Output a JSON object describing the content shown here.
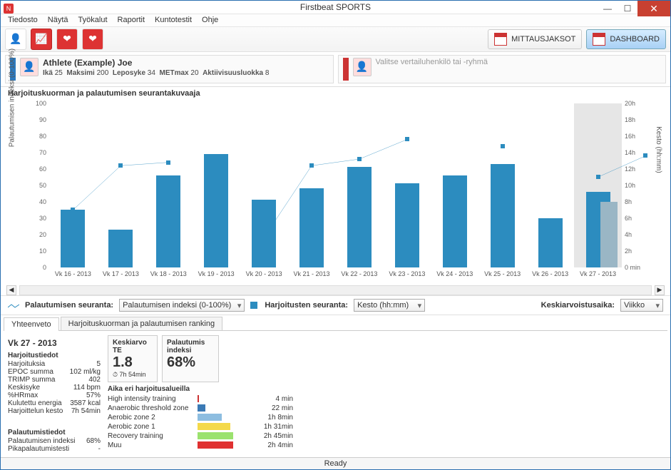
{
  "app": {
    "title": "Firstbeat SPORTS"
  },
  "menu": [
    "Tiedosto",
    "Näytä",
    "Työkalut",
    "Raportit",
    "Kuntotestit",
    "Ohje"
  ],
  "toolbar_right": {
    "mittaus": "MITTAUSJAKSOT",
    "dashboard": "DASHBOARD"
  },
  "athlete": {
    "name": "Athlete (Example) Joe",
    "ika_lbl": "Ikä",
    "ika": "25",
    "maksimi_lbl": "Maksimi",
    "maksimi": "200",
    "lepo_lbl": "Leposyke",
    "lepo": "34",
    "met_lbl": "METmax",
    "met": "20",
    "akt_lbl": "Aktiivisuusluokka",
    "akt": "8",
    "compare_placeholder": "Valitse vertailuhenkilö tai -ryhmä"
  },
  "chart_title": "Harjoituskuorman ja palautumisen seurantakuvaaja",
  "chart_data": {
    "type": "bar+line",
    "categories": [
      "Vk 16 - 2013",
      "Vk 17 - 2013",
      "Vk 18 - 2013",
      "Vk 19 - 2013",
      "Vk 20 - 2013",
      "Vk 21 - 2013",
      "Vk 22 - 2013",
      "Vk 23 - 2013",
      "Vk 24 - 2013",
      "Vk 25 - 2013",
      "Vk 26 - 2013",
      "Vk 27 - 2013"
    ],
    "series": [
      {
        "name": "Palautumisen indeksi (0-100%)",
        "axis": "left",
        "type": "bar",
        "values": [
          35,
          23,
          56,
          69,
          41,
          48,
          61,
          51,
          56,
          63,
          30,
          46,
          40
        ]
      },
      {
        "name": "Kesto (hh:mm)",
        "axis": "right",
        "type": "line",
        "values": [
          7,
          12.4,
          12.8,
          null,
          3.6,
          12.4,
          13.2,
          15.6,
          null,
          14.8,
          null,
          11,
          13.6
        ]
      }
    ],
    "ylabel_left": "Palautumisen indeksi (0-100%)",
    "ylabel_right": "Kesto (hh:mm)",
    "ylim_left": [
      0,
      100
    ],
    "ylim_right": [
      0,
      20
    ],
    "highlight_index": 11,
    "yticks_left": [
      "0",
      "10",
      "20",
      "30",
      "40",
      "50",
      "60",
      "70",
      "80",
      "90",
      "100"
    ],
    "yticks_right": [
      "0 min",
      "2h",
      "4h",
      "6h",
      "8h",
      "10h",
      "12h",
      "14h",
      "16h",
      "18h",
      "20h"
    ]
  },
  "filters": {
    "pal_lbl": "Palautumisen seuranta:",
    "pal_sel": "Palautumisen indeksi (0-100%)",
    "har_lbl": "Harjoitusten seuranta:",
    "har_sel": "Kesto (hh:mm)",
    "avg_lbl": "Keskiarvoistusaika:",
    "avg_sel": "Viikko"
  },
  "tabs": {
    "t1": "Yhteenveto",
    "t2": "Harjoituskuorman ja palautumisen ranking"
  },
  "summary": {
    "header": "Vk 27 - 2013",
    "harj_hd": "Harjoitustiedot",
    "rows": [
      [
        "Harjoituksia",
        "5"
      ],
      [
        "EPOC summa",
        "102 ml/kg"
      ],
      [
        "TRIMP summa",
        "402"
      ],
      [
        "Keskisyke",
        "114 bpm"
      ],
      [
        "%HRmax",
        "57%"
      ],
      [
        "Kulutettu energia",
        "3587 kcal"
      ],
      [
        "Harjoittelun kesto",
        "7h 54min"
      ]
    ],
    "pal_hd": "Palautumistiedot",
    "pal_rows": [
      [
        "Palautumisen indeksi",
        "68%"
      ],
      [
        "Pikapalautumistesti",
        "-"
      ]
    ],
    "te_card": {
      "title": "Keskiarvo TE",
      "value": "1.8",
      "sub": "7h 54min"
    },
    "idx_card": {
      "title": "Palautumis indeksi",
      "value": "68%"
    },
    "zones_hd": "Aika eri harjoitusalueilla",
    "zones": [
      {
        "name": "High intensity training",
        "color": "#c33",
        "w": 4,
        "time": "4 min"
      },
      {
        "name": "Anaerobic threshold zone",
        "color": "#3b7ab5",
        "w": 22,
        "time": "22 min"
      },
      {
        "name": "Aerobic zone 2",
        "color": "#8dbde0",
        "w": 68,
        "time": "1h 8min"
      },
      {
        "name": "Aerobic zone 1",
        "color": "#f4d94a",
        "w": 91,
        "time": "1h 31min"
      },
      {
        "name": "Recovery training",
        "color": "#9be26e",
        "w": 100,
        "time": "2h 45min"
      },
      {
        "name": "Muu",
        "color": "#e03131",
        "w": 100,
        "time": "2h 4min"
      }
    ]
  },
  "status": "Ready"
}
